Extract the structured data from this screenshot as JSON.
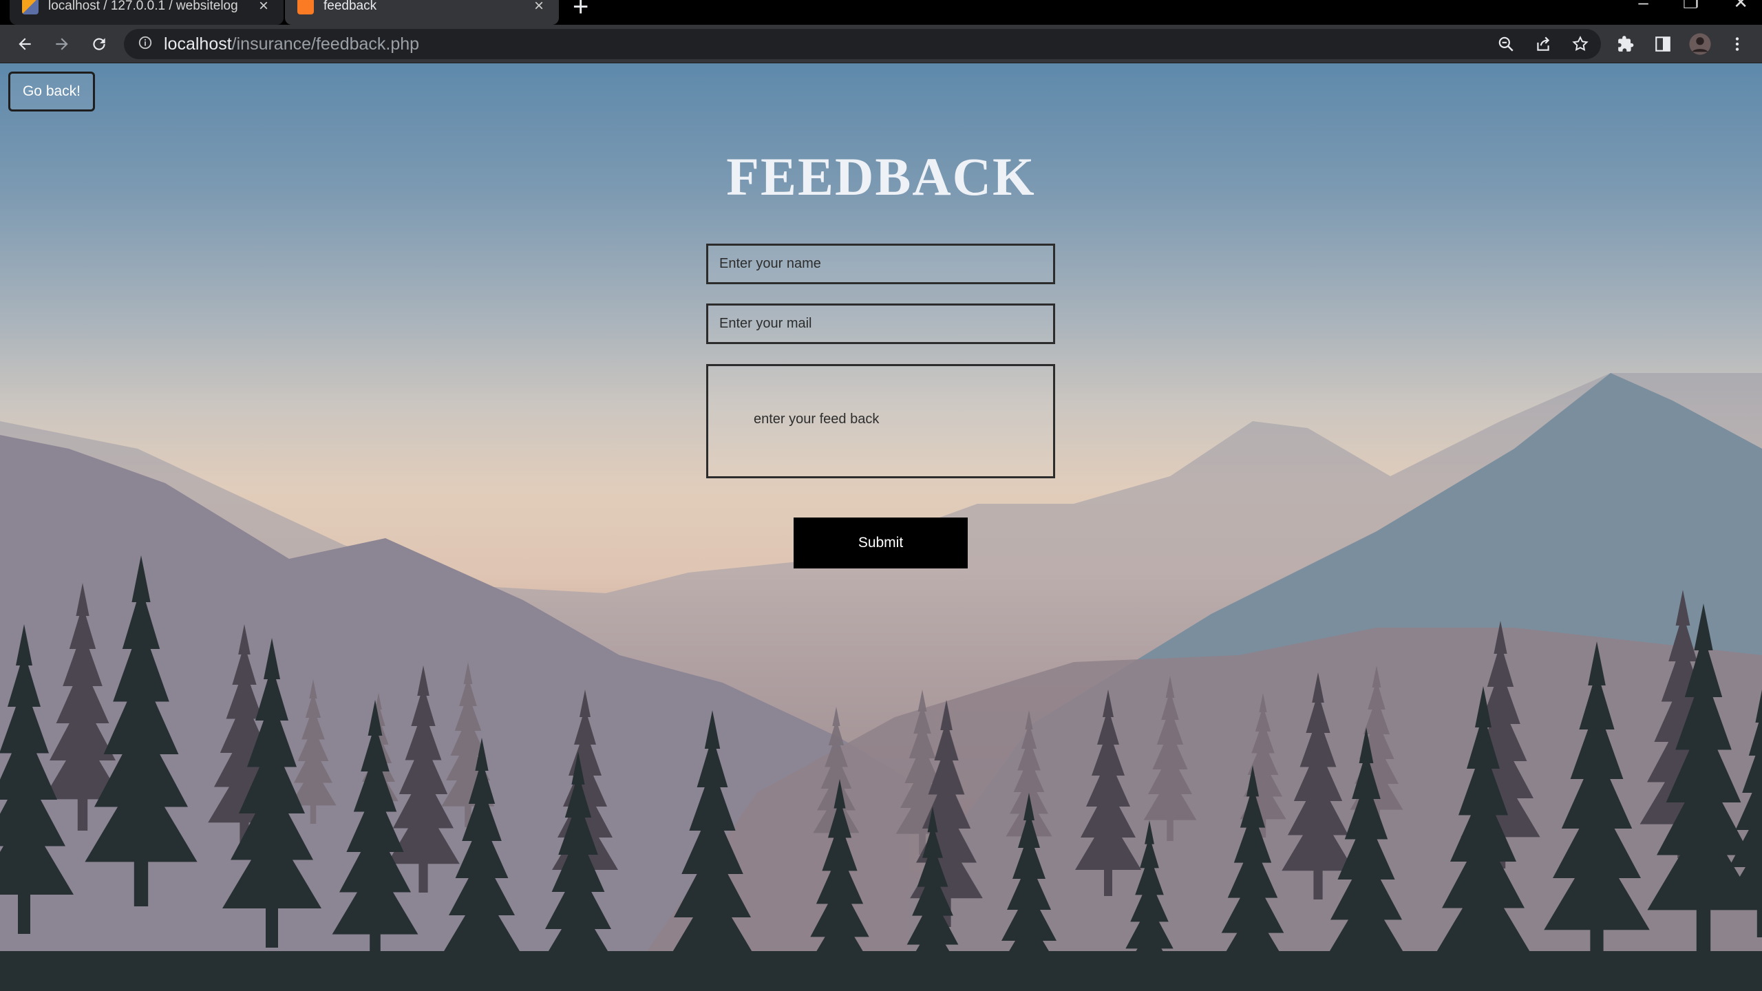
{
  "browser": {
    "tabs": [
      {
        "title": "localhost / 127.0.0.1 / websitelog",
        "active": false,
        "favicon": "phpmyadmin-icon"
      },
      {
        "title": "feedback",
        "active": true,
        "favicon": "xampp-icon"
      }
    ],
    "url": {
      "host": "localhost",
      "path": "/insurance/feedback.php"
    }
  },
  "page": {
    "go_back_label": "Go back!",
    "heading": "FEEDBACK",
    "name_placeholder": "Enter your name",
    "mail_placeholder": "Enter your mail",
    "feedback_placeholder": "enter your feed back",
    "submit_label": "Submit"
  },
  "colors": {
    "sky_top": "#5e89ab",
    "horizon": "#e1cdbb",
    "forest_dark": "#263033",
    "button_bg": "#000000"
  }
}
